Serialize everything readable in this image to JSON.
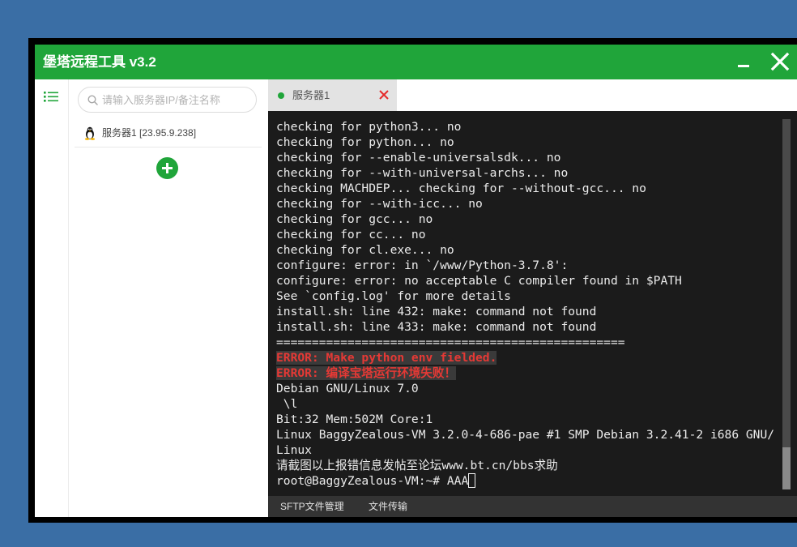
{
  "window": {
    "title": "堡塔远程工具 v3.2",
    "minimize_icon": "minimize-icon",
    "close_icon": "close-icon"
  },
  "colors": {
    "desktop": "#3a6ea5",
    "brand_green": "#20a53a",
    "error_text": "#e53935",
    "tab_close": "#e52b2b",
    "terminal_bg": "#1b1b1b"
  },
  "sidebar": {
    "menu_icon": "list-icon",
    "search": {
      "icon": "search-icon",
      "placeholder": "请输入服务器IP/备注名称",
      "value": ""
    },
    "servers": [
      {
        "os_icon": "linux-penguin-icon",
        "label": "服务器1 [23.95.9.238]"
      }
    ],
    "add_icon": "plus-icon"
  },
  "tabs": [
    {
      "label": "服务器1",
      "status_color": "#20a53a",
      "close_icon": "close-icon"
    }
  ],
  "terminal": {
    "lines": [
      {
        "text": "checking for python3... no"
      },
      {
        "text": "checking for python... no"
      },
      {
        "text": "checking for --enable-universalsdk... no"
      },
      {
        "text": "checking for --with-universal-archs... no"
      },
      {
        "text": "checking MACHDEP... checking for --without-gcc... no"
      },
      {
        "text": "checking for --with-icc... no"
      },
      {
        "text": "checking for gcc... no"
      },
      {
        "text": "checking for cc... no"
      },
      {
        "text": "checking for cl.exe... no"
      },
      {
        "text": "configure: error: in `/www/Python-3.7.8':"
      },
      {
        "text": "configure: error: no acceptable C compiler found in $PATH"
      },
      {
        "text": "See `config.log' for more details"
      },
      {
        "text": "install.sh: line 432: make: command not found"
      },
      {
        "text": "install.sh: line 433: make: command not found"
      },
      {
        "text": "================================================="
      },
      {
        "text": "ERROR: Make python env fielded.",
        "error": true
      },
      {
        "text": "ERROR: 编译宝塔运行环境失败！",
        "error": true
      },
      {
        "text": "Debian GNU/Linux 7.0"
      },
      {
        "text": " \\l"
      },
      {
        "text": "Bit:32 Mem:502M Core:1"
      },
      {
        "text": "Linux BaggyZealous-VM 3.2.0-4-686-pae #1 SMP Debian 3.2.41-2 i686 GNU/"
      },
      {
        "text": "Linux"
      },
      {
        "text": "请截图以上报错信息发帖至论坛www.bt.cn/bbs求助"
      }
    ],
    "prompt": "root@BaggyZealous-VM:~# ",
    "input": "AAA",
    "scroll_position": 1.0
  },
  "bottom_bar": {
    "items": [
      "SFTP文件管理",
      "文件传输"
    ]
  }
}
